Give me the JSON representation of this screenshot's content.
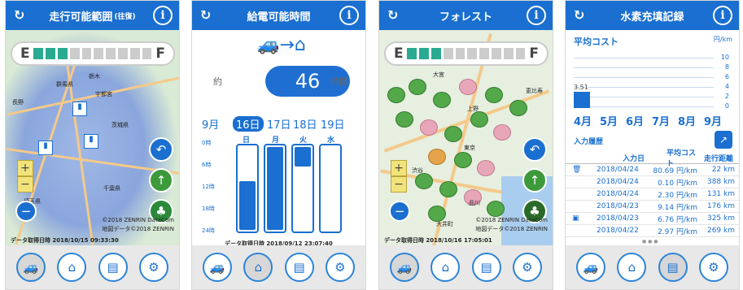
{
  "screens": [
    {
      "title": "走行可能範囲",
      "title_sub": "(往復)",
      "fuel": {
        "e": "E",
        "f": "F",
        "filled": 3,
        "total": 10
      },
      "map_labels": [
        "長野",
        "群馬県",
        "栃木",
        "宇都宮",
        "茨城県",
        "千葉県",
        "埼玉県"
      ],
      "copyright": "©2018 ZENRIN DataCom",
      "copyright2": "地図データ©2018 ZENRIN",
      "timestamp": "データ取得日時 2018/10/15 09:33:30"
    },
    {
      "title": "給電可能時間",
      "approx": "約",
      "value": "46",
      "unit": "時間",
      "days": [
        "9月",
        "16日",
        "17日",
        "18日",
        "19日"
      ],
      "weekdays": [
        "日",
        "月",
        "火",
        "水"
      ],
      "hours": [
        "0時",
        "6時",
        "12時",
        "18時",
        "24時"
      ],
      "timestamp": "データ取得日時 2018/09/12 23:07:40"
    },
    {
      "title": "フォレスト",
      "fuel": {
        "e": "E",
        "f": "F",
        "filled": 3,
        "total": 10
      },
      "map_labels": [
        "大宮",
        "上野",
        "東京",
        "渋谷",
        "恵比寿",
        "品川",
        "大井町"
      ],
      "copyright": "©2018 ZENRIN DataCom",
      "copyright2": "地図データ©2018 ZENRIN",
      "timestamp": "データ取得日時 2018/10/16 17:05:01"
    },
    {
      "title": "水素充填記録",
      "avg_cost_label": "平均コスト",
      "unit": "円/km",
      "y_ticks": [
        "10",
        "8",
        "6",
        "4",
        "2",
        "0"
      ],
      "current_value": "3.51",
      "months": [
        "4月",
        "5月",
        "6月",
        "7月",
        "8月",
        "9月"
      ],
      "input_history_label": "入力履歴",
      "table_headers": [
        "入力日",
        "平均コスト",
        "走行距離"
      ],
      "rows": [
        {
          "date": "2018/04/24",
          "cost": "80.69 円/km",
          "dist": "22 km"
        },
        {
          "date": "2018/04/24",
          "cost": "0.10 円/km",
          "dist": "388 km"
        },
        {
          "date": "2018/04/24",
          "cost": "2.30 円/km",
          "dist": "131 km"
        },
        {
          "date": "2018/04/23",
          "cost": "9.14 円/km",
          "dist": "176 km"
        },
        {
          "date": "2018/04/23",
          "cost": "6.76 円/km",
          "dist": "325 km"
        },
        {
          "date": "2018/04/22",
          "cost": "2.97 円/km",
          "dist": "269 km"
        }
      ],
      "page_dots": "● ● ●"
    }
  ],
  "nav_icons": [
    "car-icon",
    "home-icon",
    "list-icon",
    "gear-icon"
  ],
  "colors": {
    "primary": "#1a6fd0",
    "teal": "#2aaa90",
    "green": "#3d9a3a"
  }
}
